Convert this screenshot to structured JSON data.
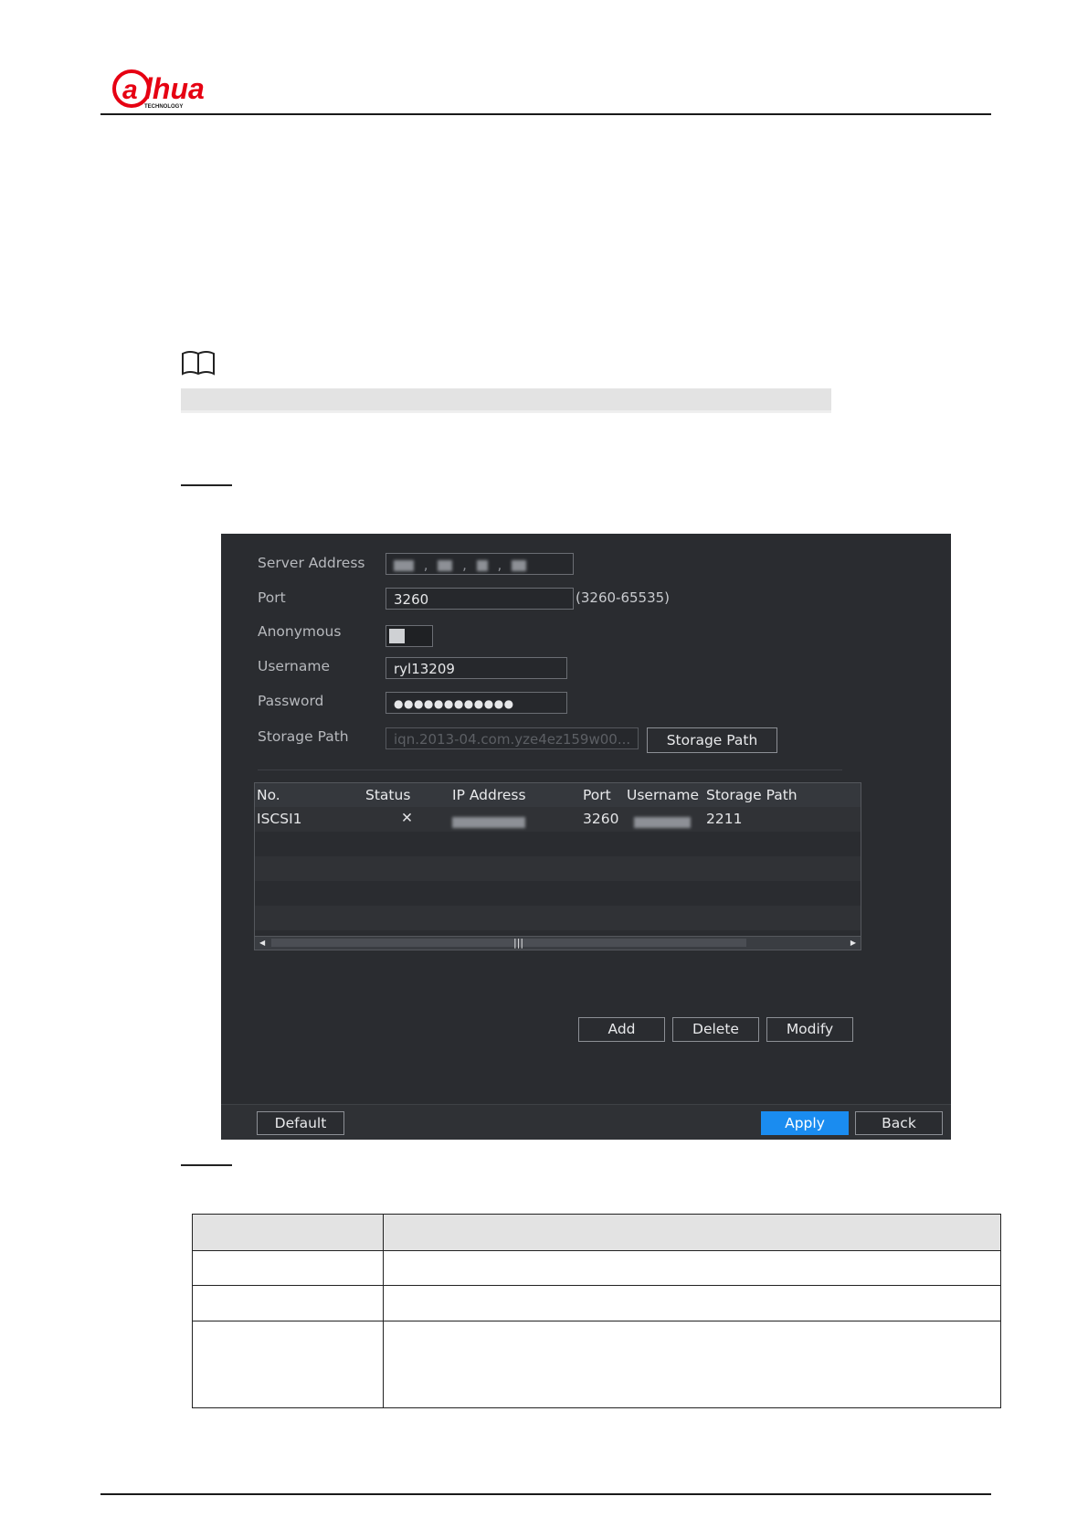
{
  "brand": {
    "logo_text": "alhua",
    "logo_subtext": "TECHNOLOGY",
    "logo_color": "#e60012"
  },
  "device_ui": {
    "fields": {
      "server_address_label": "Server Address",
      "port_label": "Port",
      "port_value": "3260",
      "port_range_hint": "(3260-65535)",
      "anonymous_label": "Anonymous",
      "username_label": "Username",
      "username_value": "ryl13209",
      "password_label": "Password",
      "password_value": "●●●●●●●●●●●●",
      "storage_path_label": "Storage Path",
      "storage_path_value": "iqn.2013-04.com.yze4ez159w00...",
      "storage_path_button": "Storage Path"
    },
    "table": {
      "headers": [
        "No.",
        "Status",
        "IP Address",
        "Port",
        "Username",
        "Storage Path"
      ],
      "rows": [
        {
          "no": "ISCSI1",
          "status_icon": "x-mark-icon",
          "port": "3260",
          "storage_path": "2211"
        }
      ]
    },
    "buttons": {
      "add": "Add",
      "delete": "Delete",
      "modify": "Modify",
      "default": "Default",
      "apply": "Apply",
      "back": "Back"
    },
    "colors": {
      "panel_bg": "#2a2c30",
      "apply_bg": "#1a8cf0",
      "status_error": "#e23a3a"
    }
  }
}
